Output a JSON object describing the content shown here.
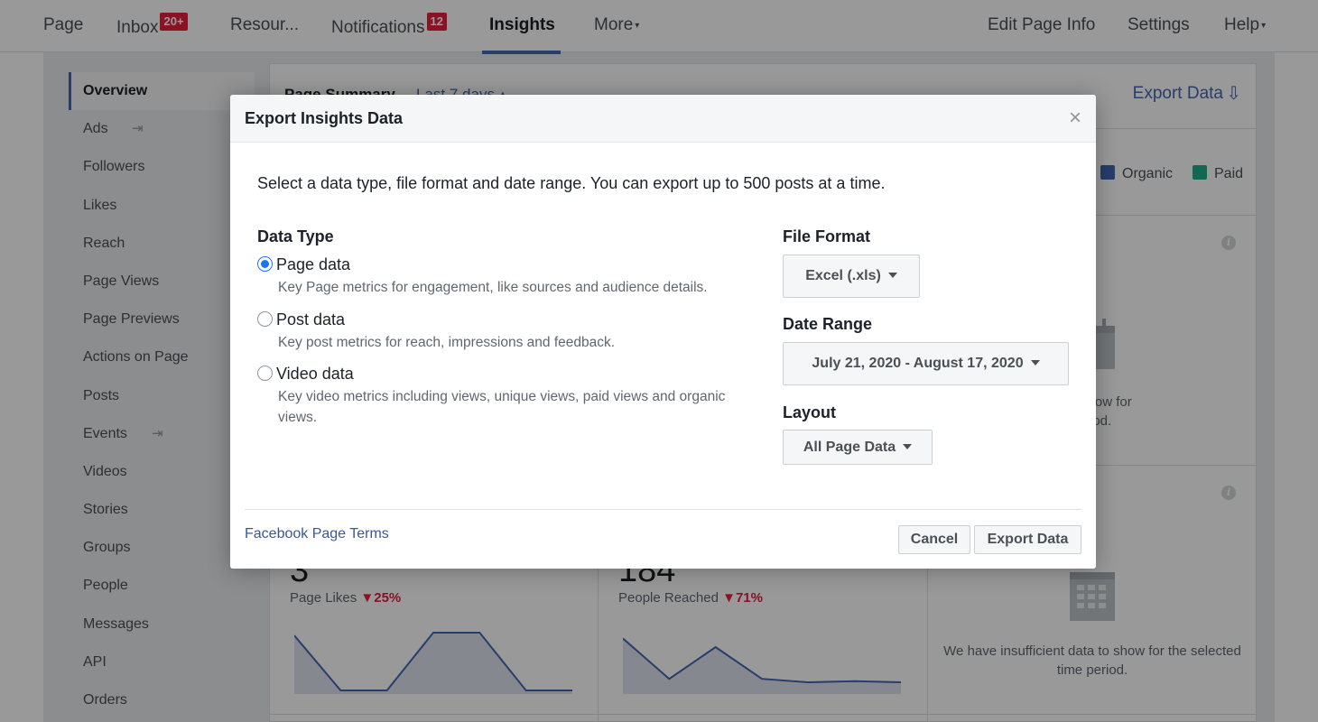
{
  "topnav": {
    "items": [
      {
        "label": "Page"
      },
      {
        "label": "Inbox",
        "badge": "20+"
      },
      {
        "label": "Resour..."
      },
      {
        "label": "Notifications",
        "badge": "12"
      },
      {
        "label": "Insights",
        "active": true
      },
      {
        "label": "More",
        "caret": "▾"
      },
      {
        "label": "Edit Page Info"
      },
      {
        "label": "Settings"
      },
      {
        "label": "Help",
        "caret": "▾"
      }
    ]
  },
  "sidebar": {
    "items": [
      {
        "label": "Overview",
        "active": true
      },
      {
        "label": "Ads"
      },
      {
        "label": "Followers"
      },
      {
        "label": "Likes"
      },
      {
        "label": "Reach"
      },
      {
        "label": "Page Views"
      },
      {
        "label": "Page Previews"
      },
      {
        "label": "Actions on Page"
      },
      {
        "label": "Posts"
      },
      {
        "label": "Events"
      },
      {
        "label": "Videos"
      },
      {
        "label": "Stories"
      },
      {
        "label": "Groups"
      },
      {
        "label": "People"
      },
      {
        "label": "Messages"
      },
      {
        "label": "API"
      },
      {
        "label": "Orders"
      }
    ],
    "ext_icon": "⇥"
  },
  "main": {
    "summary_title": "Page Summary",
    "summary_range": "Last 7 days ▴",
    "export_link": "Export Data",
    "legend": [
      {
        "label": "Organic",
        "color": "#4267b2"
      },
      {
        "label": "Paid",
        "color": "#1eaf8a"
      }
    ],
    "info_icon": "i",
    "empty_msg_top_partial": "nt data to show for\ntime period.",
    "cards": [
      {
        "value": "3",
        "label": "Page Likes",
        "delta": "▼25%",
        "points": [
          0.95,
          0.0,
          0.0,
          1.0,
          1.0,
          0.0,
          0.0
        ]
      },
      {
        "value": "184",
        "label": "People Reached",
        "delta": "▼71%",
        "points": [
          0.9,
          0.2,
          0.75,
          0.2,
          0.14,
          0.16,
          0.14
        ]
      }
    ],
    "empty_msg": "We have insufficient data to show for the selected time period."
  },
  "modal": {
    "title": "Export Insights Data",
    "close": "×",
    "description": "Select a data type, file format and date range. You can export up to 500 posts at a time.",
    "data_type_label": "Data Type",
    "options": [
      {
        "label": "Page data",
        "desc": "Key Page metrics for engagement, like sources and audience details.",
        "selected": true
      },
      {
        "label": "Post data",
        "desc": "Key post metrics for reach, impressions and feedback.",
        "selected": false
      },
      {
        "label": "Video data",
        "desc": "Key video metrics including views, unique views, paid views and organic views.",
        "selected": false
      }
    ],
    "file_format_label": "File Format",
    "file_format_value": "Excel (.xls)",
    "date_range_label": "Date Range",
    "date_range_value": "July 21, 2020 - August 17, 2020",
    "layout_label": "Layout",
    "layout_value": "All Page Data",
    "terms_link": "Facebook Page Terms",
    "cancel_label": "Cancel",
    "export_label": "Export Data"
  }
}
